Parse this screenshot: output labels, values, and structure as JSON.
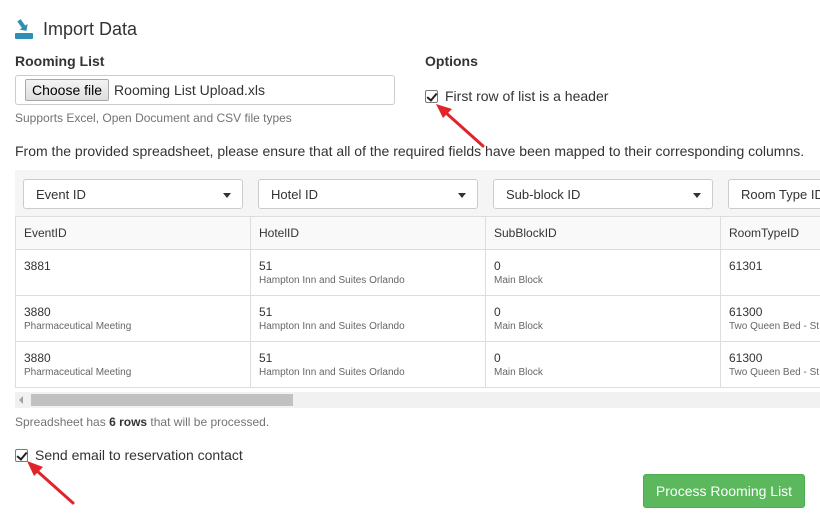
{
  "page": {
    "title": "Import Data"
  },
  "rooming_list": {
    "label": "Rooming List",
    "choose_file_label": "Choose file",
    "file_name": "Rooming List Upload.xls",
    "help_text": "Supports Excel, Open Document and CSV file types"
  },
  "options": {
    "label": "Options",
    "header_checkbox_label": "First row of list is a header",
    "header_checked": true
  },
  "instructions": "From the provided spreadsheet, please ensure that all of the required fields have been mapped to their corresponding columns.",
  "mappings": [
    "Event ID",
    "Hotel ID",
    "Sub-block ID",
    "Room Type ID"
  ],
  "table": {
    "headers": [
      "EventID",
      "HotelID",
      "SubBlockID",
      "RoomTypeID"
    ],
    "rows": [
      [
        {
          "value": "3881",
          "sub": ""
        },
        {
          "value": "51",
          "sub": "Hampton Inn and Suites Orlando"
        },
        {
          "value": "0",
          "sub": "Main Block"
        },
        {
          "value": "61301",
          "sub": ""
        }
      ],
      [
        {
          "value": "3880",
          "sub": "Pharmaceutical Meeting"
        },
        {
          "value": "51",
          "sub": "Hampton Inn and Suites Orlando"
        },
        {
          "value": "0",
          "sub": "Main Block"
        },
        {
          "value": "61300",
          "sub": "Two Queen Bed - St"
        }
      ],
      [
        {
          "value": "3880",
          "sub": "Pharmaceutical Meeting"
        },
        {
          "value": "51",
          "sub": "Hampton Inn and Suites Orlando"
        },
        {
          "value": "0",
          "sub": "Main Block"
        },
        {
          "value": "61300",
          "sub": "Two Queen Bed - St"
        }
      ]
    ]
  },
  "summary": {
    "prefix": "Spreadsheet has ",
    "count": "6 rows",
    "suffix": " that will be processed."
  },
  "send_email": {
    "label": "Send email to reservation contact",
    "checked": true
  },
  "process_button": "Process Rooming List",
  "icons": {
    "title": "import-icon",
    "select_caret": "caret-down-icon"
  },
  "colors": {
    "primary_button": "#5cb85c",
    "annotation_arrow": "#e0242a",
    "import_icon": "#2e8fb3"
  }
}
